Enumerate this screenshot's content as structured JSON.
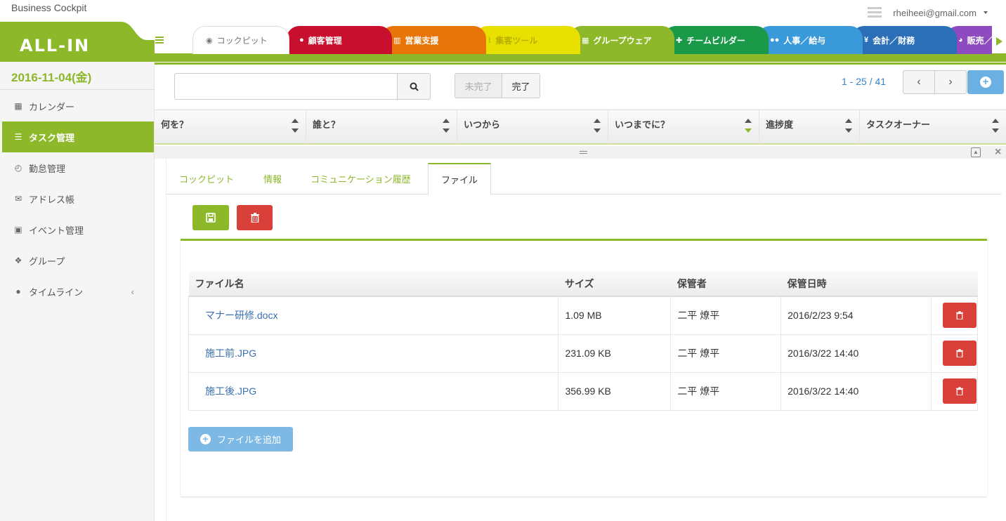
{
  "app": {
    "title": "Business Cockpit",
    "logo": "ALL-IN",
    "user": "rheiheei@gmail.com"
  },
  "tabs": [
    {
      "label": "コックピット",
      "icon": "dashboard-icon",
      "color": "#ffffff"
    },
    {
      "label": "顧客管理",
      "icon": "comments-icon",
      "color": "#c8102e"
    },
    {
      "label": "営業支援",
      "icon": "bar-chart-icon",
      "color": "#e8750a"
    },
    {
      "label": "集客ツール",
      "icon": "line-chart-icon",
      "color": "#e8e000"
    },
    {
      "label": "グループウェア",
      "icon": "calendar-icon",
      "color": "#8cb829"
    },
    {
      "label": "チームビルダー",
      "icon": "user-plus-icon",
      "color": "#1a9a48"
    },
    {
      "label": "人事／給与",
      "icon": "users-icon",
      "color": "#3a9ad9"
    },
    {
      "label": "会計／財務",
      "icon": "yen-icon",
      "color": "#2a6fb8"
    },
    {
      "label": "販売／",
      "icon": "pie-chart-icon",
      "color": "#8e4bbf"
    }
  ],
  "sidebar": {
    "date": "2016-11-04(金)",
    "items": [
      {
        "label": "カレンダー",
        "icon": "calendar-icon"
      },
      {
        "label": "タスク管理",
        "icon": "tasks-icon"
      },
      {
        "label": "勤怠管理",
        "icon": "clock-icon"
      },
      {
        "label": "アドレス帳",
        "icon": "envelope-icon"
      },
      {
        "label": "イベント管理",
        "icon": "calendar-event-icon"
      },
      {
        "label": "グループ",
        "icon": "cubes-icon"
      },
      {
        "label": "タイムライン",
        "icon": "comments-icon"
      }
    ]
  },
  "toolbar": {
    "search_value": "",
    "filter_incomplete": "未完了",
    "filter_complete": "完了",
    "pager": "1 - 25 / 41"
  },
  "grid": {
    "columns": [
      "何を？",
      "誰と？",
      "いつから",
      "いつまでに？",
      "進捗度",
      "タスクオーナー"
    ]
  },
  "detail": {
    "tabs": [
      "コックピット",
      "情報",
      "コミュニケーション履歴",
      "ファイル"
    ],
    "table": {
      "headers": [
        "ファイル名",
        "サイズ",
        "保管者",
        "保管日時"
      ],
      "rows": [
        {
          "name": "マナー研修.docx",
          "size": "1.09 MB",
          "owner": "二平 燎平",
          "date": "2016/2/23 9:54"
        },
        {
          "name": "施工前.JPG",
          "size": "231.09 KB",
          "owner": "二平 燎平",
          "date": "2016/3/22 14:40"
        },
        {
          "name": "施工後.JPG",
          "size": "356.99 KB",
          "owner": "二平 燎平",
          "date": "2016/3/22 14:40"
        }
      ]
    },
    "add_file": "ファイルを追加"
  },
  "colors": {
    "accent": "#8cb829",
    "danger": "#d9403a",
    "info": "#7db9e4",
    "link": "#3a84c9"
  }
}
